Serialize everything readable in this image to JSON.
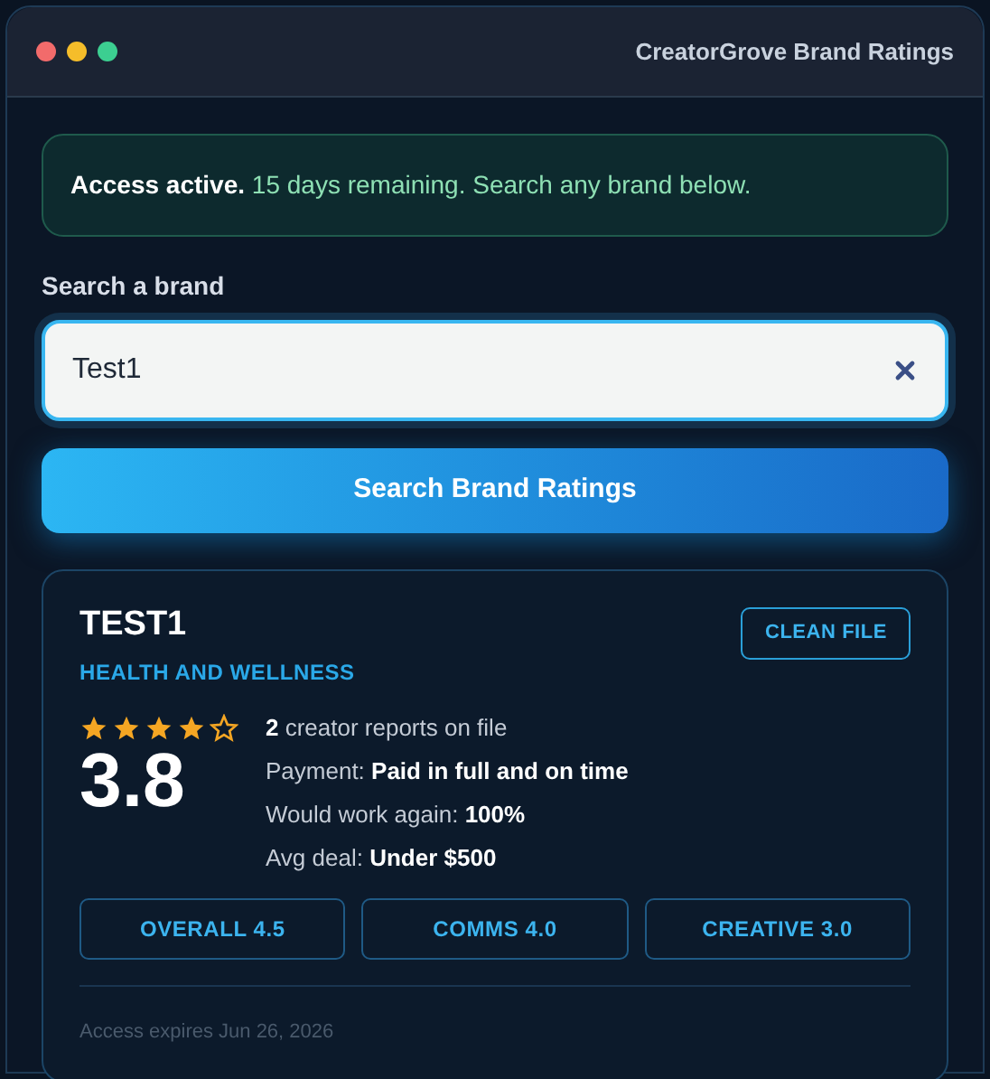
{
  "window": {
    "title": "CreatorGrove Brand Ratings"
  },
  "notice": "**Access active.** 15 days remaining. Search any brand below.",
  "search": {
    "label": "Search a brand",
    "value": "Test1",
    "button": "Search Brand Ratings"
  },
  "result": {
    "name": "TEST1",
    "category": "HEALTH AND WELLNESS",
    "badge": "CLEAN FILE",
    "stars": 4,
    "score": "3.8",
    "facts": [
      "**2** creator reports on file",
      "Payment: **Paid in full and on time**",
      "Would work again: **100%**",
      "Avg deal: **Under $500**"
    ],
    "ratings": [
      "OVERALL 4.5",
      "COMMS 4.0",
      "CREATIVE 3.0"
    ],
    "footer": "Access expires Jun 26, 2026"
  }
}
